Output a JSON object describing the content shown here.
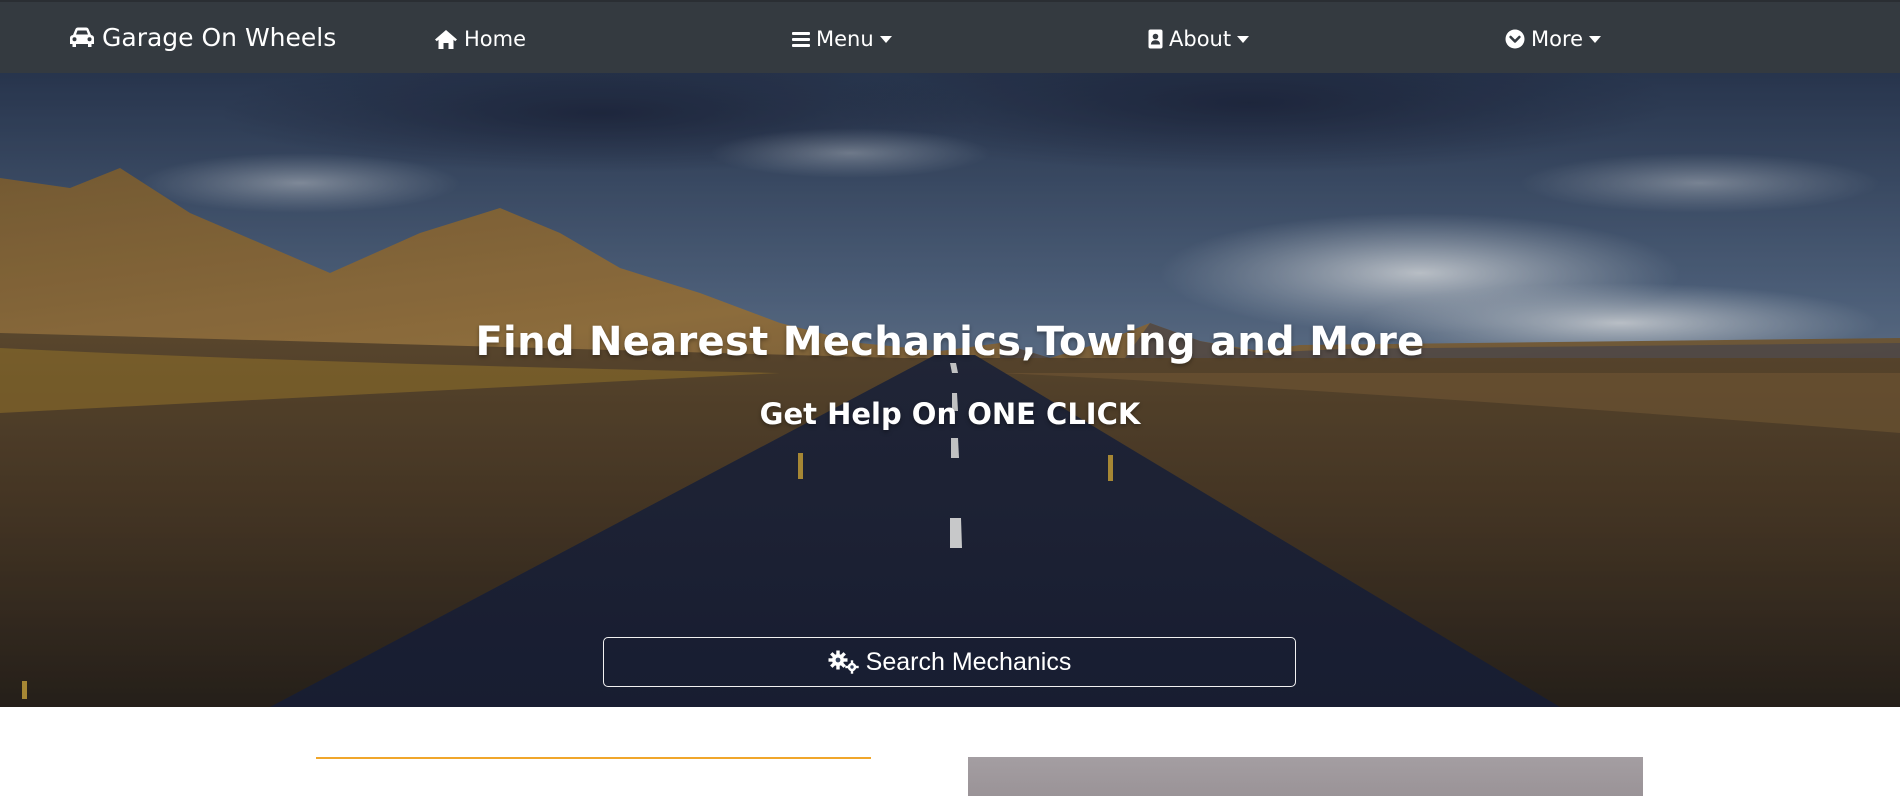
{
  "navbar": {
    "brand": {
      "label": "Garage On Wheels",
      "icon": "car-icon"
    },
    "items": [
      {
        "label": "Home",
        "icon": "home-icon",
        "dropdown": false
      },
      {
        "label": "Menu",
        "icon": "bars-icon",
        "dropdown": true
      },
      {
        "label": "About",
        "icon": "address-card-icon",
        "dropdown": true
      },
      {
        "label": "More",
        "icon": "chevron-circle-down-icon",
        "dropdown": true
      }
    ]
  },
  "hero": {
    "title": "Find Nearest Mechanics,Towing and More",
    "subtitle": "Get Help On ONE CLICK",
    "search_button": {
      "label": "Search Mechanics",
      "icon": "gears-icon"
    }
  },
  "colors": {
    "navbar_bg": "#343a40",
    "accent_line": "#f0a62b",
    "text_white": "#ffffff"
  }
}
